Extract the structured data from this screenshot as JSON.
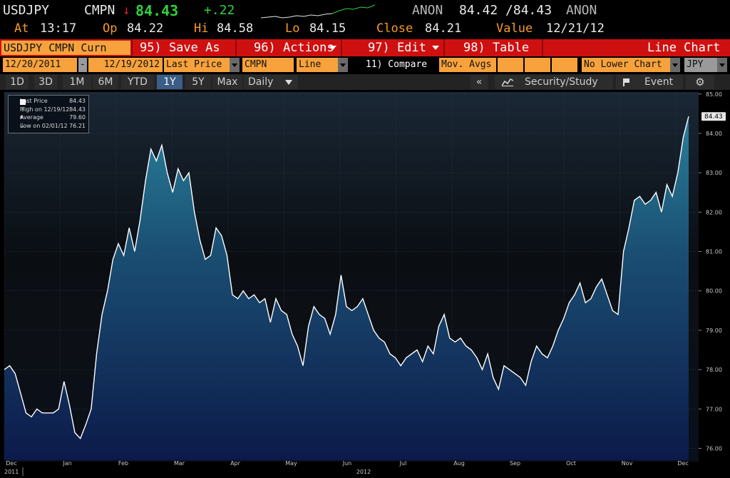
{
  "header": {
    "ticker": "USDJPY",
    "source": "CMPN",
    "arrow": "↓",
    "last": "84.43",
    "change": "+.22",
    "anon_left": "ANON",
    "bid_ask": "84.42 /84.43",
    "anon_right": "ANON",
    "at_label": "At",
    "at_value": "13:17",
    "op_label": "Op",
    "op_value": "84.22",
    "hi_label": "Hi",
    "hi_value": "84.58",
    "lo_label": "Lo",
    "lo_value": "84.15",
    "close_label": "Close",
    "close_value": "84.21",
    "value_label": "Value",
    "value_date": "12/21/12"
  },
  "toolbar": {
    "security": "USDJPY CMPN Curn",
    "save_as": "95) Save As",
    "actions": "96) Actions",
    "edit": "97) Edit",
    "table": "98) Table",
    "chart_type": "Line Chart"
  },
  "params": {
    "start_date": "12/20/2011",
    "dash": "-",
    "end_date": "12/19/2012",
    "field": "Last Price",
    "source": "CMPN",
    "style": "Line",
    "compare": "11) Compare",
    "mov_avgs": "Mov. Avgs",
    "lower_chart": "No Lower Chart",
    "currency": "JPY"
  },
  "ranges": {
    "items": [
      "1D",
      "3D",
      "1M",
      "6M",
      "YTD",
      "1Y",
      "5Y",
      "Max"
    ],
    "selected": "1Y",
    "frequency": "Daily",
    "collapse": "«",
    "security_study": "Security/Study",
    "event": "Event"
  },
  "legend": {
    "last_label": "Last Price",
    "last_value": "84.43",
    "high_label": "High on 12/19/12",
    "high_value": "84.43",
    "avg_label": "Average",
    "avg_value": "79.60",
    "low_label": "Low on 02/01/12",
    "low_value": "76.21"
  },
  "colors": {
    "accent_orange": "#f79a2a",
    "toolbar_red": "#cf1010",
    "up_green": "#2fd23a",
    "line_white": "#ffffff"
  },
  "chart_data": {
    "type": "area",
    "y_ticks": [
      "85.00",
      "84.00",
      "83.00",
      "82.00",
      "81.00",
      "80.00",
      "79.00",
      "78.00",
      "77.00",
      "76.00"
    ],
    "ylim": [
      75.7,
      85.05
    ],
    "last_marker": "84.43",
    "x_months": [
      "Dec",
      "Jan",
      "Feb",
      "Mar",
      "Apr",
      "May",
      "Jun",
      "Jul",
      "Aug",
      "Sep",
      "Oct",
      "Nov",
      "Dec"
    ],
    "x_years": [
      "2011",
      "2012"
    ],
    "x": [
      0,
      2,
      4,
      6,
      8,
      10,
      12,
      14,
      16,
      18,
      20,
      22,
      24,
      26,
      28,
      30,
      32,
      34,
      36,
      38,
      40,
      42,
      44,
      46,
      48,
      50,
      52,
      54,
      56,
      58,
      60,
      62,
      64,
      66,
      68,
      70,
      72,
      74,
      76,
      78,
      80,
      82,
      84,
      86,
      88,
      90,
      92,
      94,
      96,
      98,
      100,
      102,
      104,
      106,
      108,
      110,
      112,
      114,
      116,
      118,
      120,
      122,
      124,
      126,
      128,
      130,
      132,
      134,
      136,
      138,
      140,
      142,
      144,
      146,
      148,
      150,
      152,
      154,
      156,
      158,
      160,
      162,
      164,
      166,
      168,
      170,
      172,
      174,
      176,
      178,
      180,
      182,
      184,
      186,
      188,
      190,
      192,
      194,
      196,
      198,
      200,
      202,
      204,
      206,
      208,
      210,
      212,
      214,
      216,
      218,
      220,
      222,
      224,
      226,
      228,
      230,
      232,
      234,
      236,
      238,
      240,
      242,
      244,
      246,
      248,
      250,
      252
    ],
    "values": [
      78.0,
      78.1,
      77.9,
      77.4,
      76.9,
      76.8,
      77.0,
      76.9,
      76.9,
      76.9,
      77.0,
      77.7,
      77.1,
      76.4,
      76.25,
      76.6,
      77.0,
      78.4,
      79.4,
      80.0,
      80.8,
      81.2,
      80.9,
      81.6,
      81.0,
      81.8,
      82.8,
      83.6,
      83.3,
      83.7,
      83.0,
      82.5,
      83.1,
      82.8,
      83.0,
      82.0,
      81.3,
      80.8,
      80.9,
      81.6,
      81.4,
      80.9,
      79.9,
      79.8,
      80.0,
      79.8,
      79.9,
      79.7,
      79.8,
      79.2,
      79.8,
      79.5,
      79.4,
      78.9,
      78.6,
      78.1,
      79.1,
      79.6,
      79.4,
      79.3,
      78.9,
      79.4,
      80.4,
      79.6,
      79.5,
      79.6,
      79.8,
      79.4,
      79.0,
      78.8,
      78.7,
      78.4,
      78.3,
      78.1,
      78.3,
      78.4,
      78.5,
      78.2,
      78.6,
      78.4,
      79.1,
      79.4,
      78.8,
      78.7,
      78.8,
      78.6,
      78.5,
      78.3,
      78.0,
      78.4,
      77.8,
      77.5,
      78.1,
      78.0,
      77.9,
      77.8,
      77.6,
      78.2,
      78.6,
      78.4,
      78.3,
      78.6,
      79.0,
      79.3,
      79.7,
      79.9,
      80.2,
      79.7,
      79.8,
      80.1,
      80.3,
      79.9,
      79.5,
      79.4,
      81.0,
      81.6,
      82.3,
      82.4,
      82.2,
      82.3,
      82.5,
      82.0,
      82.7,
      82.4,
      83.0,
      83.9,
      84.43
    ]
  }
}
